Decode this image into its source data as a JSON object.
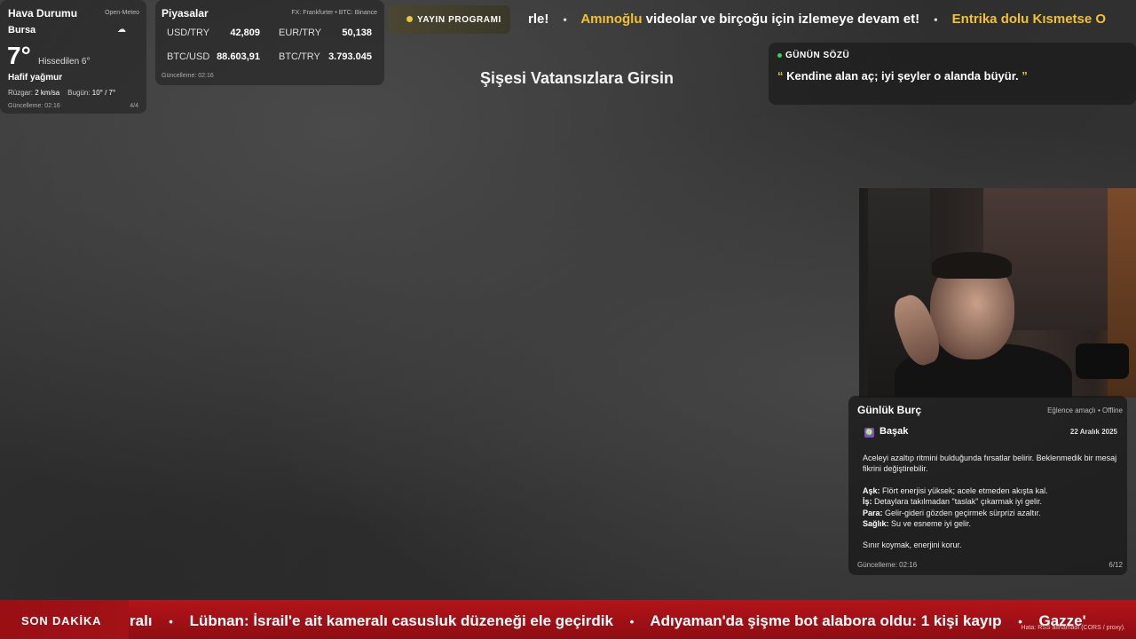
{
  "weather": {
    "title": "Hava Durumu",
    "source": "Open-Meteo",
    "city": "Bursa",
    "icon": "cloud-sun-icon",
    "temp": "7°",
    "feels": "Hissedilen 6°",
    "condition": "Hafif yağmur",
    "wind_label": "Rüzgar:",
    "wind_value": "2 km/sa",
    "today_label": "Bugün:",
    "today_value": "10° / 7°",
    "updated": "Güncelleme: 02:16",
    "page": "4/4"
  },
  "markets": {
    "title": "Piyasalar",
    "source": "FX: Frankfurter • BTC: Binance",
    "rates": [
      {
        "label": "USD/TRY",
        "value": "42,809"
      },
      {
        "label": "EUR/TRY",
        "value": "50,138"
      },
      {
        "label": "BTC/USD",
        "value": "88.603,91"
      },
      {
        "label": "BTC/TRY",
        "value": "3.793.045"
      }
    ],
    "updated": "Güncelleme: 02:16"
  },
  "top_ticker": {
    "badge": "YAYIN PROGRAMI",
    "items": [
      {
        "text": "rle!",
        "color": "white"
      },
      {
        "highlight": "Amınoğlu",
        "text": " videolar ve birçoğu için izlemeye devam et!"
      },
      {
        "highlight": "Entrika dolu Kısmetse O",
        "text": ""
      }
    ]
  },
  "center_title": "Şişesi Vatansızlara Girsin",
  "quote": {
    "label": "GÜNÜN SÖZÜ",
    "open": "“",
    "text": " Kendine alan aç; iyi şeyler o alanda büyür. ",
    "close": "”"
  },
  "horoscope": {
    "title": "Günlük Burç",
    "source": "Eğlence amaçlı • Offline",
    "sign_icon": "virgo-icon",
    "sign_glyph": "♍",
    "sign": "Başak",
    "date": "22 Aralık 2025",
    "intro": "Aceleyi azaltıp ritmini bulduğunda fırsatlar belirir. Beklenmedik bir mesaj fikrini değiştirebilir.",
    "love_label": "Aşk:",
    "love": " Flört enerjisi yüksek; acele etmeden akışta kal.",
    "work_label": "İş:",
    "work": " Detaylara takılmadan \"taslak\" çıkarmak iyi gelir.",
    "money_label": "Para:",
    "money": " Gelir-gideri gözden geçirmek sürprizi azaltır.",
    "health_label": "Sağlık:",
    "health": " Su ve esneme iyi gelir.",
    "closing": "Sınır koymak, enerjini korur.",
    "updated": "Güncelleme: 02:16",
    "page": "6/12"
  },
  "breaking": {
    "badge": "SON DAKİKA",
    "items": [
      "ralı",
      "Lübnan: İsrail'e ait kameralı casusluk düzeneği ele geçirdik",
      "Adıyaman'da şişme bot alabora oldu: 1 kişi kayıp",
      "Gazze'"
    ],
    "error": "Hata: RSS alınamadı (CORS / proxy)."
  },
  "colors": {
    "accent_yellow": "#f2c230",
    "breaking_red": "#b3141a",
    "live_green": "#36d25a"
  }
}
